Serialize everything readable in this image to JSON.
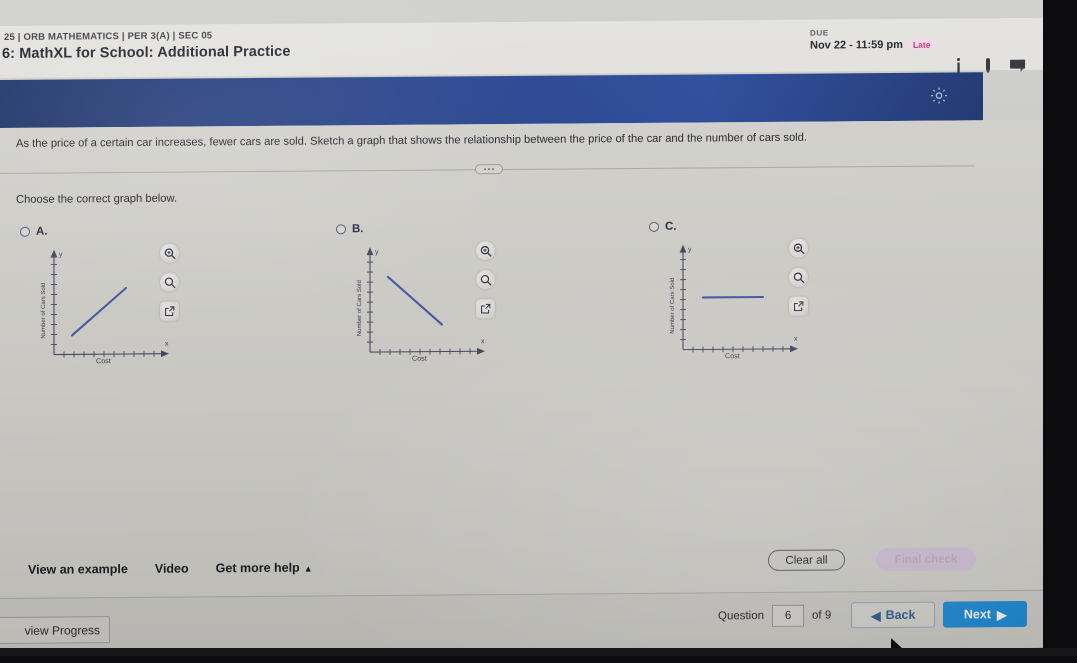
{
  "header": {
    "breadcrumb": "25 | ORB MATHEMATICS | PER 3(A) | SEC 05",
    "assignment_title": "6: MathXL for School: Additional Practice",
    "due_label": "DUE",
    "due_date": "Nov 22 - 11:59 pm",
    "late_badge": "Late",
    "icons": {
      "info": "info-icon",
      "attachment": "pencil-icon",
      "message": "chat-icon"
    }
  },
  "banner": {
    "settings_icon": "gear-icon"
  },
  "question": {
    "prompt": "As the price of a certain car increases, fewer cars are sold. Sketch a graph that shows the relationship between the price of the car and the number of cars sold.",
    "instruction": "Choose the correct graph below.",
    "options": [
      {
        "letter": "A.",
        "selected": false,
        "graph": {
          "xlabel": "Cost",
          "ylabel": "Number of Cars Sold",
          "x_axis_var": "x",
          "y_axis_var": "y",
          "shape": "increasing"
        }
      },
      {
        "letter": "B.",
        "selected": false,
        "graph": {
          "xlabel": "Cost",
          "ylabel": "Number of Cars Sold",
          "x_axis_var": "x",
          "y_axis_var": "y",
          "shape": "decreasing"
        }
      },
      {
        "letter": "C.",
        "selected": false,
        "graph": {
          "xlabel": "Cost",
          "ylabel": "Number of Cars Sold",
          "x_axis_var": "x",
          "y_axis_var": "y",
          "shape": "constant"
        }
      }
    ],
    "tools": {
      "zoom_in": "zoom-in-icon",
      "magnifier": "magnifier-icon",
      "popout": "popout-icon"
    }
  },
  "help": {
    "view_example": "View an example",
    "video": "Video",
    "get_more_help": "Get more help",
    "caret": "▲"
  },
  "actions": {
    "clear_all": "Clear all",
    "final_check": "Final check"
  },
  "footer": {
    "review_progress": "view Progress",
    "question_label": "Question",
    "question_number": "6",
    "of_label": "of 9",
    "back": "Back",
    "next": "Next",
    "back_arrow": "◀",
    "next_arrow": "▶"
  },
  "colors": {
    "banner_blue": "#26418c",
    "next_blue": "#1b8cd8",
    "graph_line": "#4b5ca6",
    "late_pink": "#b4357a",
    "final_check_lavender": "#d5c4da"
  }
}
